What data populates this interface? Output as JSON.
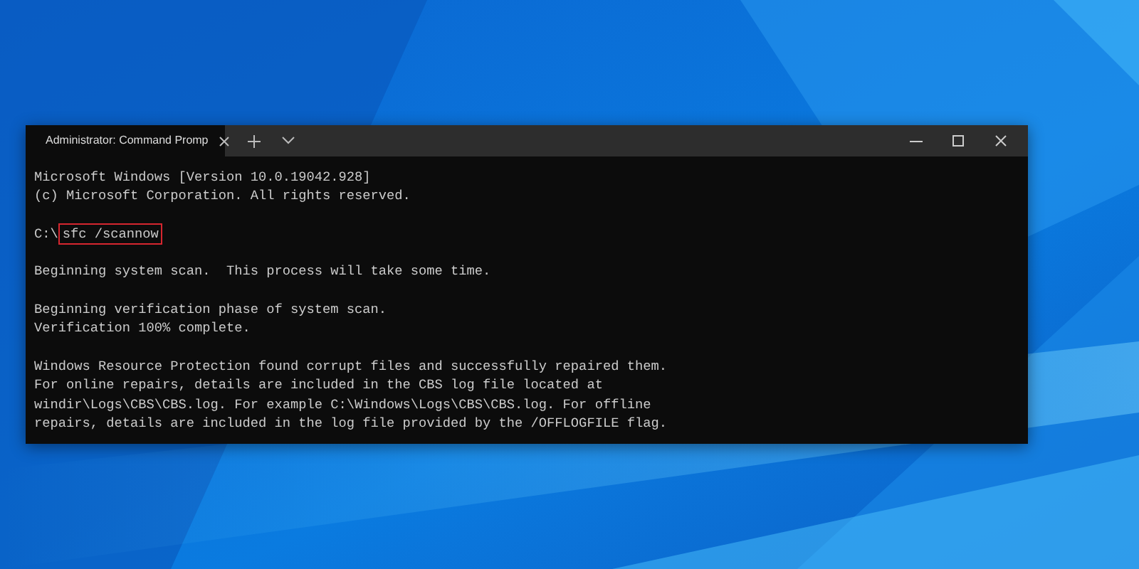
{
  "window": {
    "tab": {
      "title": "Administrator: Command Promp",
      "selected": true
    }
  },
  "console": {
    "blocks": [
      [
        {
          "kind": "output",
          "text": "Microsoft Windows [Version 10.0.19042.928]"
        },
        {
          "kind": "output",
          "text": "(c) Microsoft Corporation. All rights reserved."
        }
      ],
      [
        {
          "kind": "prompt",
          "prompt": "C:\\",
          "command": "sfc /scannow",
          "highlighted": true
        }
      ],
      [
        {
          "kind": "output",
          "text": "Beginning system scan.  This process will take some time."
        }
      ],
      [
        {
          "kind": "output",
          "text": "Beginning verification phase of system scan."
        },
        {
          "kind": "output",
          "text": "Verification 100% complete."
        }
      ],
      [
        {
          "kind": "output",
          "text": "Windows Resource Protection found corrupt files and successfully repaired them."
        },
        {
          "kind": "output",
          "text": "For online repairs, details are included in the CBS log file located at"
        },
        {
          "kind": "output",
          "text": "windir\\Logs\\CBS\\CBS.log. For example C:\\Windows\\Logs\\CBS\\CBS.log. For offline"
        },
        {
          "kind": "output",
          "text": "repairs, details are included in the log file provided by the /OFFLOGFILE flag."
        }
      ]
    ]
  }
}
